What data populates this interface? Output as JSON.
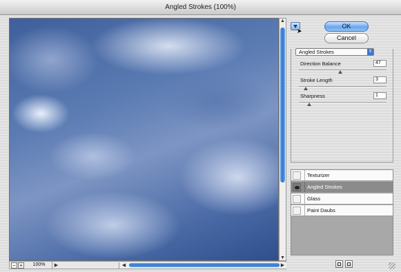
{
  "window": {
    "title": "Angled Strokes (100%)"
  },
  "preview": {
    "zoom_level": "100%",
    "zoom_out": "−",
    "zoom_in": "+"
  },
  "buttons": {
    "ok": "OK",
    "cancel": "Cancel"
  },
  "filter_select": {
    "value": "Angled Strokes"
  },
  "params": [
    {
      "label": "Direction Balance",
      "value": "47",
      "level": 47,
      "max": 100
    },
    {
      "label": "Stroke Length",
      "value": "3",
      "level": 3,
      "max": 50
    },
    {
      "label": "Sharpness",
      "value": "1",
      "level": 1,
      "max": 10
    }
  ],
  "layers": [
    {
      "name": "Texturizer",
      "visible": false,
      "active": false
    },
    {
      "name": "Angled Strokes",
      "visible": true,
      "active": true
    },
    {
      "name": "Glass",
      "visible": false,
      "active": false
    },
    {
      "name": "Paint Daubs",
      "visible": false,
      "active": false
    }
  ],
  "colors": {
    "accent": "#3d78cf",
    "ok_button": "#6aa6ec",
    "active_layer": "#8b8b8b"
  }
}
